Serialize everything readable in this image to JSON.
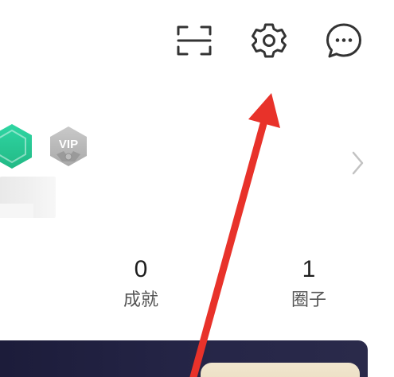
{
  "header": {
    "icons": {
      "scan": "scan-icon",
      "settings": "gear-icon",
      "messages": "chat-bubble-icon"
    }
  },
  "profile": {
    "badges": {
      "vip_label": "VIP"
    },
    "chevron": "chevron-right-icon"
  },
  "stats": [
    {
      "value": "0",
      "label": "成就"
    },
    {
      "value": "1",
      "label": "圈子"
    }
  ],
  "annotation": {
    "arrow_color": "#e8322a"
  }
}
